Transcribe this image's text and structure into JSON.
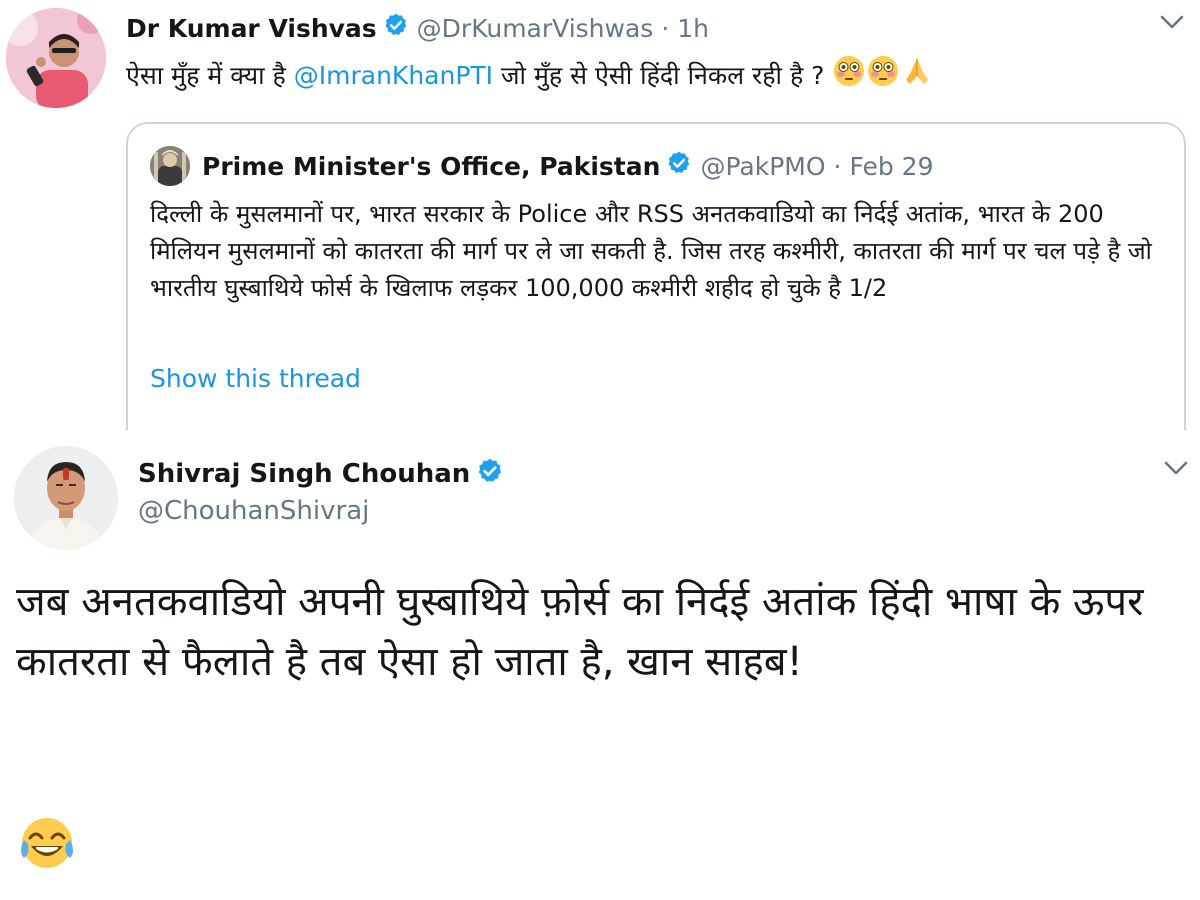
{
  "tweet1": {
    "author": {
      "name": "Dr Kumar Vishvas",
      "handle": "@DrKumarVishwas",
      "timestamp": "1h",
      "separator": "·",
      "verified_icon": "verified-badge-icon"
    },
    "text": {
      "before_mention": "ऐसा मुँह में क्या है ",
      "mention": "@ImranKhanPTI",
      "after_mention": " जो मुँह से ऐसी हिंदी निकल रही है ? "
    },
    "emojis": [
      "flushed-face-icon",
      "flushed-face-icon",
      "folded-hands-icon"
    ],
    "menu_icon": "chevron-down-icon",
    "quoted_tweet": {
      "author": {
        "name": "Prime Minister's Office, Pakistan",
        "handle": "@PakPMO",
        "timestamp": "Feb 29",
        "separator": "·"
      },
      "text": "दिल्ली के मुसलमानों पर, भारत सरकार के Police और RSS अनतकवाडियो का निर्दई अतांक,  भारत के 200 मिलियन मुसलमानों को कातरता की मार्ग पर ले जा सकती है. जिस तरह कश्मीरी, कातरता की मार्ग पर चल पड़े है जो भारतीय घुस्बाथिये फोर्स के खिलाफ लड़कर 100,000 कश्मीरी शहीद हो चुके है 1/2",
      "show_thread": "Show this thread"
    }
  },
  "tweet2": {
    "author": {
      "name": "Shivraj Singh Chouhan",
      "handle": "@ChouhanShivraj",
      "verified_icon": "verified-badge-icon"
    },
    "menu_icon": "chevron-down-icon",
    "text": "जब अनतकवाडियो अपनी घुस्बाथिये फ़ोर्स का निर्दई अतांक हिंदी भाषा के ऊपर कातरता से फैलाते है तब ऐसा हो जाता है, खान साहब!",
    "emoji": "tears-of-joy-icon"
  },
  "colors": {
    "link": "#1b95e0",
    "secondary_text": "#657786",
    "primary_text": "#14171a",
    "border": "#ccd6dd",
    "verified": "#1da1f2"
  }
}
